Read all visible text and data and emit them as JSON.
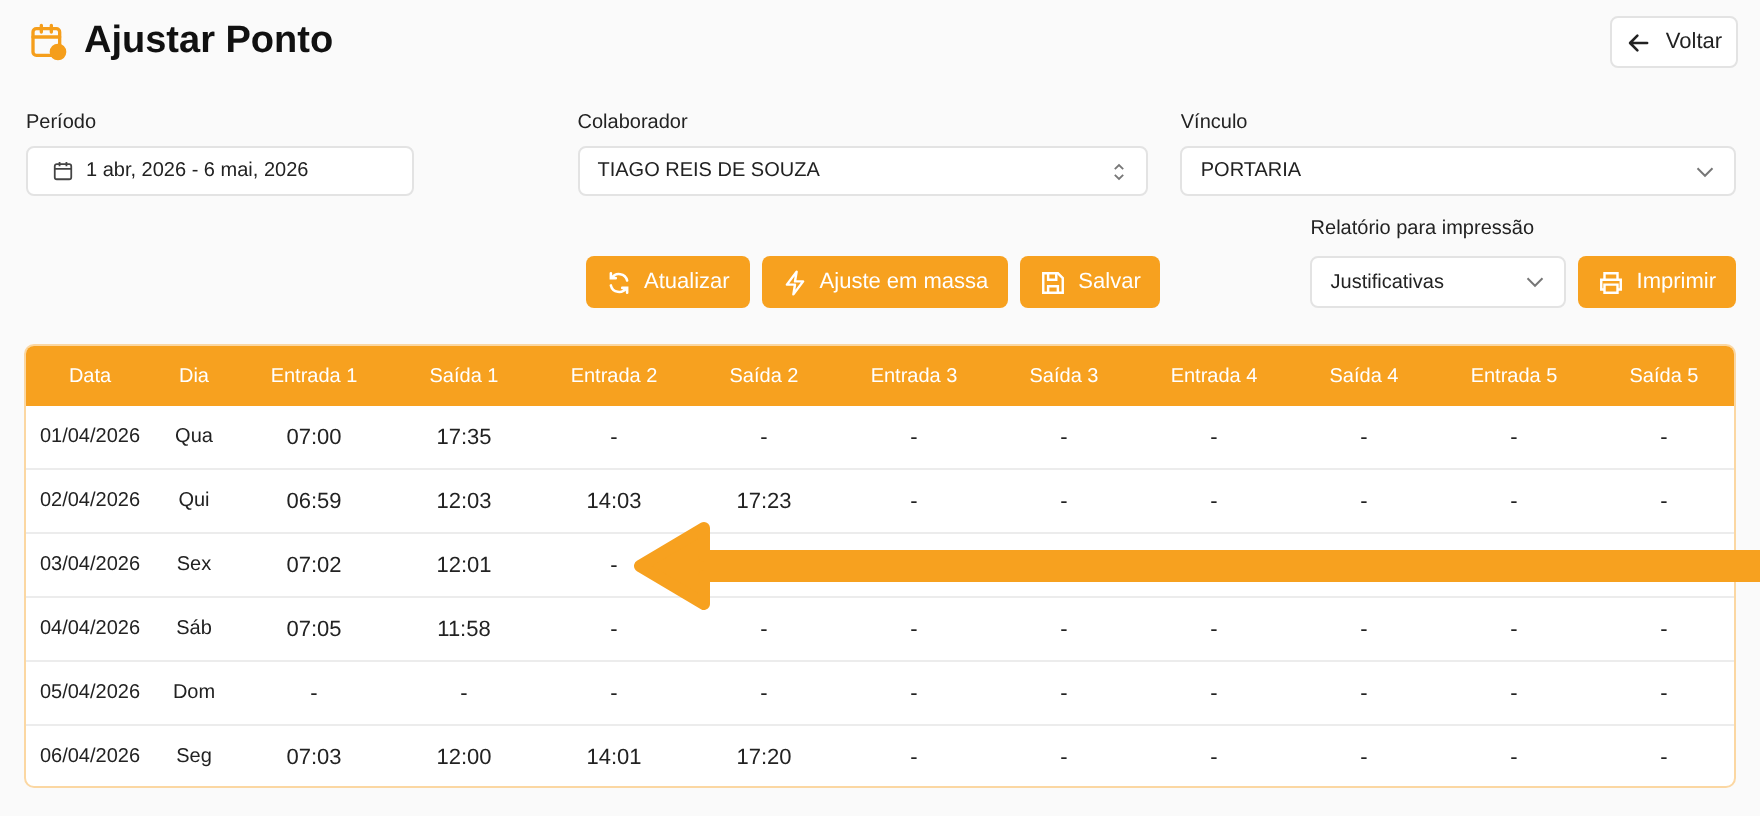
{
  "page": {
    "title": "Ajustar Ponto",
    "back_button": "Voltar"
  },
  "filters": {
    "period": {
      "label": "Período",
      "value": "1 abr, 2026 - 6 mai, 2026"
    },
    "employee": {
      "label": "Colaborador",
      "value": "TIAGO REIS DE SOUZA"
    },
    "link": {
      "label": "Vínculo",
      "value": "PORTARIA"
    },
    "report": {
      "label": "Relatório para impressão",
      "value": "Justificativas"
    }
  },
  "actions": [
    {
      "kind": "refresh",
      "label": "Atualizar"
    },
    {
      "kind": "bulk",
      "label": "Ajuste em massa"
    },
    {
      "kind": "save",
      "label": "Salvar"
    }
  ],
  "print_button": "Imprimir",
  "table": {
    "columns": [
      "Data",
      "Dia",
      "Entrada 1",
      "Saída 1",
      "Entrada 2",
      "Saída 2",
      "Entrada 3",
      "Saída 3",
      "Entrada 4",
      "Saída 4",
      "Entrada 5",
      "Saída 5"
    ],
    "rows": [
      [
        "01/04/2026",
        "Qua",
        "07:00",
        "17:35",
        "-",
        "-",
        "-",
        "-",
        "-",
        "-",
        "-",
        "-"
      ],
      [
        "02/04/2026",
        "Qui",
        "06:59",
        "12:03",
        "14:03",
        "17:23",
        "-",
        "-",
        "-",
        "-",
        "-",
        "-"
      ],
      [
        "03/04/2026",
        "Sex",
        "07:02",
        "12:01",
        "-"
      ],
      [
        "04/04/2026",
        "Sáb",
        "07:05",
        "11:58",
        "-",
        "-",
        "-",
        "-",
        "-",
        "-",
        "-",
        "-"
      ],
      [
        "05/04/2026",
        "Dom",
        "-",
        "-",
        "-",
        "-",
        "-",
        "-",
        "-",
        "-",
        "-",
        "-"
      ],
      [
        "06/04/2026",
        "Seg",
        "07:03",
        "12:00",
        "14:01",
        "17:20",
        "-",
        "-",
        "-",
        "-",
        "-",
        "-"
      ]
    ]
  }
}
